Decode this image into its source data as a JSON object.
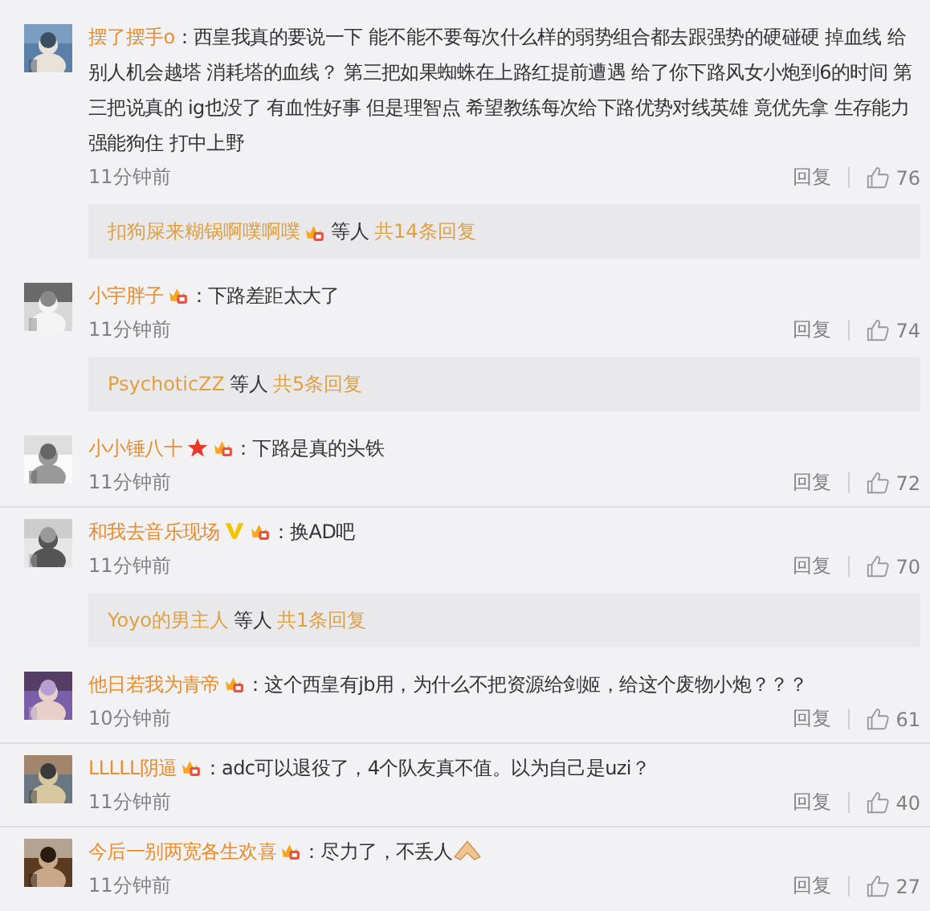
{
  "comments": [
    {
      "user": "摆了摆手o",
      "text": "：西皇我真的要说一下 能不能不要每次什么样的弱势组合都去跟强势的硬碰硬 掉血线 给别人机会越塔 消耗塔的血线？ 第三把如果蜘蛛在上路红提前遭遇 给了你下路风女小炮到6的时间 第三把说真的 ig也没了 有血性好事 但是理智点 希望教练每次给下路优势对线英雄 竟优先拿 生存能力强能狗住 打中上野",
      "time": "11分钟前",
      "reply": "回复",
      "likes": "76",
      "replies": {
        "names": "扣狗屎来糊锅啊噗啊噗",
        "badges": [
          {
            "kind": "vip"
          }
        ],
        "etc": "等人",
        "count": "共14条回复"
      }
    },
    {
      "user": "小宇胖子",
      "badges": [
        {
          "kind": "vip"
        }
      ],
      "text": "：下路差距太大了",
      "time": "11分钟前",
      "reply": "回复",
      "likes": "74",
      "replies": {
        "names": "PsychoticZZ",
        "etc": "等人",
        "count": "共5条回复"
      }
    },
    {
      "user": "小小锤八十",
      "badges": [
        {
          "kind": "star"
        },
        {
          "kind": "vip"
        }
      ],
      "text": "：下路是真的头铁",
      "time": "11分钟前",
      "reply": "回复",
      "likes": "72"
    },
    {
      "user": "和我去音乐现场",
      "badges": [
        {
          "kind": "v"
        },
        {
          "kind": "vip"
        }
      ],
      "text": "：换AD吧",
      "time": "11分钟前",
      "reply": "回复",
      "likes": "70",
      "replies": {
        "names": "Yoyo的男主人",
        "etc": "等人",
        "count": "共1条回复"
      }
    },
    {
      "user": "他日若我为青帝",
      "badges": [
        {
          "kind": "vip"
        }
      ],
      "text": "：这个西皇有jb用，为什么不把资源给剑姬，给这个废物小炮？？？",
      "time": "10分钟前",
      "reply": "回复",
      "likes": "61"
    },
    {
      "user": "LLLLL阴逼",
      "badges": [
        {
          "kind": "vip"
        }
      ],
      "text": "：adc可以退役了，4个队友真不值。以为自己是uzi？",
      "time": "11分钟前",
      "reply": "回复",
      "likes": "40"
    },
    {
      "user": "今后一别两宽各生欢喜",
      "badges": [
        {
          "kind": "vip"
        }
      ],
      "text": "：尽力了，不丢人",
      "emoji": {
        "kind": "pray"
      },
      "time": "11分钟前",
      "reply": "回复",
      "likes": "27"
    }
  ]
}
